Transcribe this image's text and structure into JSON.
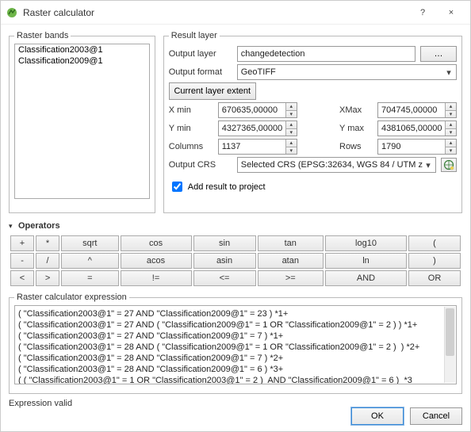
{
  "window": {
    "title": "Raster calculator",
    "help_icon": "?",
    "close_icon": "×"
  },
  "raster_bands": {
    "legend": "Raster bands",
    "items": [
      "Classification2003@1",
      "Classification2009@1"
    ]
  },
  "result_layer": {
    "legend": "Result layer",
    "output_layer_label": "Output layer",
    "output_layer_value": "changedetection",
    "browse_label": "…",
    "output_format_label": "Output format",
    "output_format_value": "GeoTIFF",
    "current_extent_label": "Current layer extent",
    "xmin_label": "X min",
    "xmin_value": "670635,00000",
    "xmax_label": "XMax",
    "xmax_value": "704745,00000",
    "ymin_label": "Y min",
    "ymin_value": "4327365,00000",
    "ymax_label": "Y max",
    "ymax_value": "4381065,00000",
    "columns_label": "Columns",
    "columns_value": "1137",
    "rows_label": "Rows",
    "rows_value": "1790",
    "crs_label": "Output CRS",
    "crs_value": "Selected CRS (EPSG:32634, WGS 84 / UTM z",
    "add_result_label": "Add result to project",
    "add_result_checked": true
  },
  "operators": {
    "legend": "Operators",
    "rows": [
      [
        "+",
        "*",
        "sqrt",
        "cos",
        "sin",
        "tan",
        "log10",
        "("
      ],
      [
        "-",
        "/",
        "^",
        "acos",
        "asin",
        "atan",
        "ln",
        ")"
      ],
      [
        "<",
        ">",
        "=",
        "!=",
        "<=",
        ">=",
        "AND",
        "OR"
      ]
    ]
  },
  "expression": {
    "legend": "Raster calculator expression",
    "lines": [
      "( \"Classification2003@1\" = 27 AND \"Classification2009@1\" = 23 ) *1+",
      "( \"Classification2003@1\" = 27 AND ( \"Classification2009@1\" = 1 OR \"Classification2009@1\" = 2 ) ) *1+",
      "( \"Classification2003@1\" = 27 AND \"Classification2009@1\" = 7 ) *1+",
      "( \"Classification2003@1\" = 28 AND ( \"Classification2009@1\" = 1 OR \"Classification2009@1\" = 2 )  ) *2+",
      "( \"Classification2003@1\" = 28 AND \"Classification2009@1\" = 7 ) *2+",
      "( \"Classification2003@1\" = 28 AND \"Classification2009@1\" = 6 ) *3+",
      "( ( \"Classification2003@1\" = 1 OR \"Classification2003@1\" = 2 )  AND \"Classification2009@1\" = 6 )  *3"
    ],
    "valid_text": "Expression valid"
  },
  "footer": {
    "ok": "OK",
    "cancel": "Cancel"
  }
}
